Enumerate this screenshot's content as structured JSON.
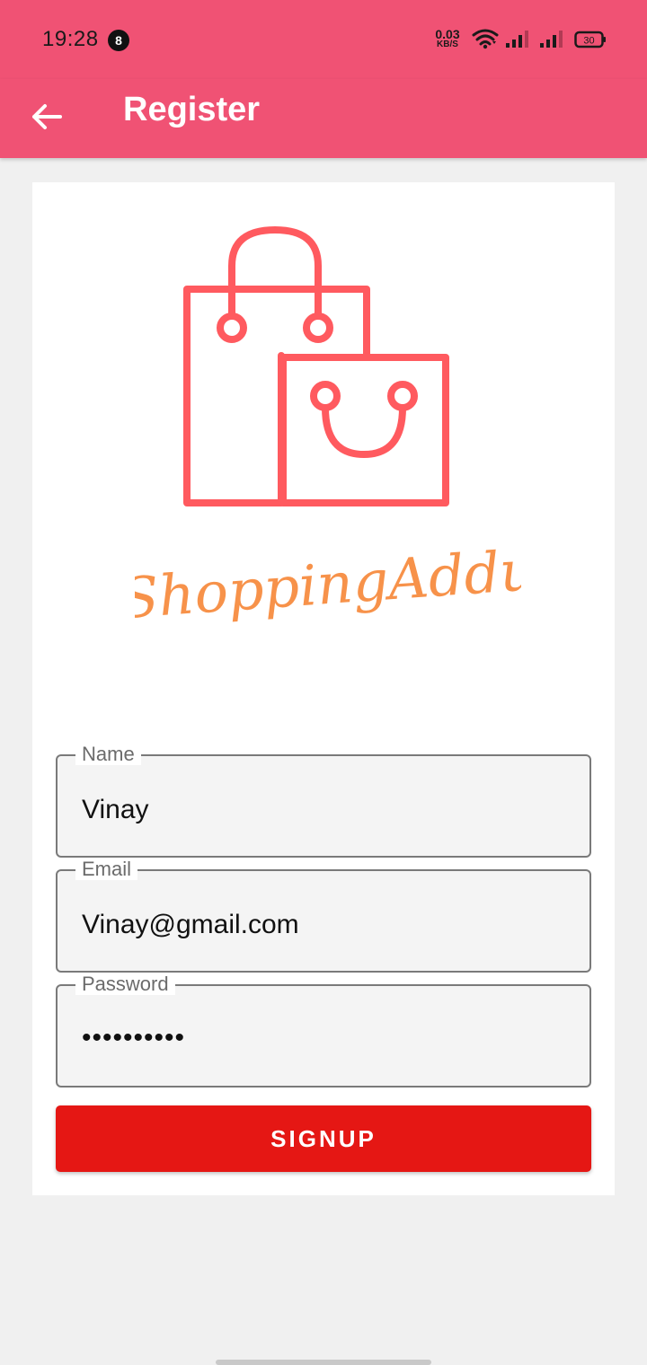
{
  "status_bar": {
    "time": "19:28",
    "notification_count": "8",
    "net_speed_value": "0.03",
    "net_speed_unit": "KB/S",
    "battery_level": "30",
    "icons": [
      "wifi-icon",
      "signal-icon",
      "signal-icon",
      "battery-icon"
    ]
  },
  "app_bar": {
    "title": "Register",
    "back_icon": "arrow-left-icon",
    "background_color": "#f05274"
  },
  "logo": {
    "brand_text": "ShoppingAddu",
    "bag_color": "#ff5a5f",
    "text_color": "#f7924a"
  },
  "form": {
    "name": {
      "label": "Name",
      "value": "Vinay"
    },
    "email": {
      "label": "Email",
      "value": "Vinay@gmail.com"
    },
    "password": {
      "label": "Password",
      "value": "••••••••••"
    },
    "signup_label": "SIGNUP",
    "signup_color": "#e51714"
  }
}
